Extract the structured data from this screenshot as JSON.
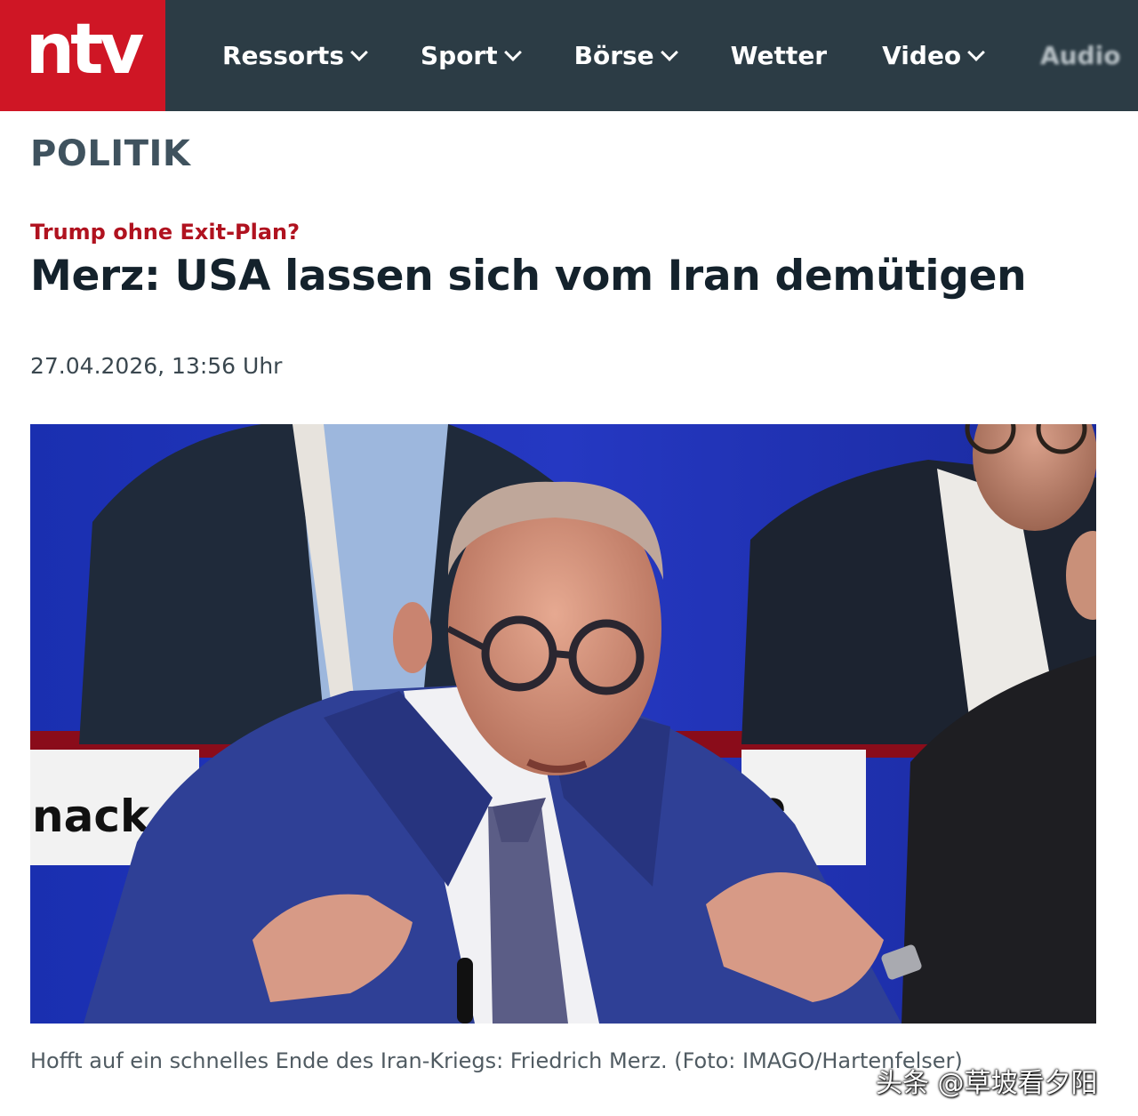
{
  "header": {
    "logo": "ntv",
    "nav": [
      {
        "label": "Ressorts",
        "has_dropdown": true
      },
      {
        "label": "Sport",
        "has_dropdown": true
      },
      {
        "label": "Börse",
        "has_dropdown": true
      },
      {
        "label": "Wetter",
        "has_dropdown": false
      },
      {
        "label": "Video",
        "has_dropdown": true
      },
      {
        "label": "Audio",
        "has_dropdown": false
      }
    ],
    "colors": {
      "bar": "#2c3c45",
      "logo_bg": "#cf1625"
    }
  },
  "article": {
    "ressort": "POLITIK",
    "kicker": "Trump ohne Exit-Plan?",
    "headline": "Merz: USA lassen sich vom Iran demütigen",
    "date": "27.04.2026, 13:56 Uhr",
    "image": {
      "nameplate_left": "nack",
      "nameplate_right": "e",
      "caption": "Hofft auf ein schnelles Ende des Iran-Kriegs: Friedrich Merz. (Foto: IMAGO/Hartenfelser)"
    }
  },
  "watermark": "头条 @草坡看夕阳"
}
